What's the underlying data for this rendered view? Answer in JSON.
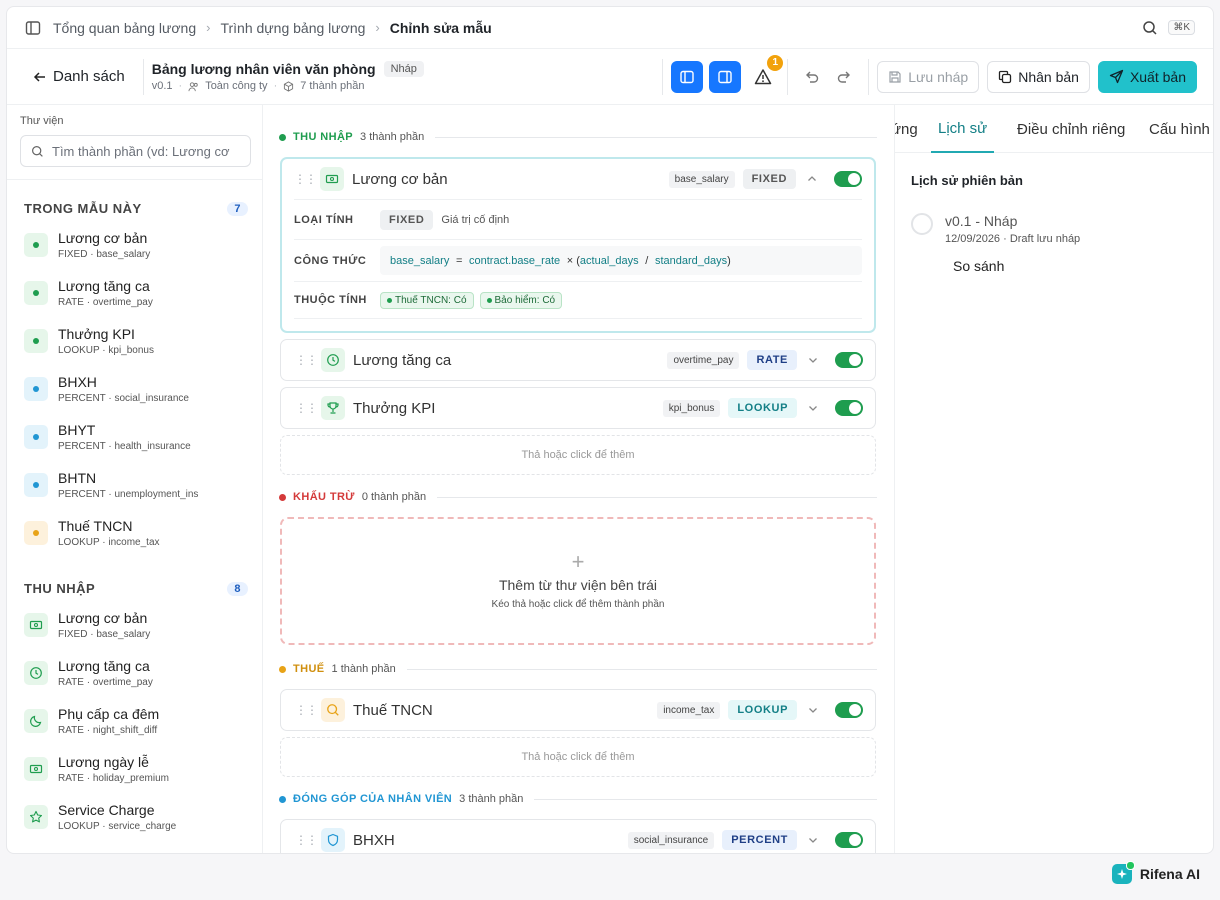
{
  "breadcrumb": [
    "Tổng quan bảng lương",
    "Trình dựng bảng lương",
    "Chỉnh sửa mẫu"
  ],
  "shortcut": "⌘K",
  "toolbar": {
    "back_label": "Danh sách",
    "title": "Bảng lương nhân viên văn phòng",
    "status": "Nháp",
    "version": "v0.1",
    "scope": "Toàn công ty",
    "components": "7 thành phần",
    "warning_count": "1",
    "save_label": "Lưu nháp",
    "duplicate_label": "Nhân bản",
    "publish_label": "Xuất bản"
  },
  "library": {
    "label": "Thư viện",
    "search_placeholder": "Tìm thành phần (vd: Lương cơ",
    "sections": [
      {
        "title": "TRONG MẪU NÀY",
        "count": "7",
        "items": [
          {
            "name": "Lương cơ bản",
            "sub": "FIXED · base_salary",
            "color": "green"
          },
          {
            "name": "Lương tăng ca",
            "sub": "RATE · overtime_pay",
            "color": "green"
          },
          {
            "name": "Thưởng KPI",
            "sub": "LOOKUP · kpi_bonus",
            "color": "green"
          },
          {
            "name": "BHXH",
            "sub": "PERCENT · social_insurance",
            "color": "blue"
          },
          {
            "name": "BHYT",
            "sub": "PERCENT · health_insurance",
            "color": "blue"
          },
          {
            "name": "BHTN",
            "sub": "PERCENT · unemployment_ins",
            "color": "blue"
          },
          {
            "name": "Thuế TNCN",
            "sub": "LOOKUP · income_tax",
            "color": "orange"
          }
        ]
      },
      {
        "title": "THU NHẬP",
        "count": "8",
        "items": [
          {
            "name": "Lương cơ bản",
            "sub": "FIXED · base_salary",
            "icon": "cash-icon"
          },
          {
            "name": "Lương tăng ca",
            "sub": "RATE · overtime_pay",
            "icon": "clock-icon"
          },
          {
            "name": "Phụ cấp ca đêm",
            "sub": "RATE · night_shift_diff",
            "icon": "moon-icon"
          },
          {
            "name": "Lương ngày lễ",
            "sub": "RATE · holiday_premium",
            "icon": "cash-icon"
          },
          {
            "name": "Service Charge",
            "sub": "LOOKUP · service_charge",
            "icon": "star-icon"
          }
        ]
      }
    ]
  },
  "groups": {
    "income": {
      "name": "THU NHẬP",
      "count": "3 thành phần"
    },
    "deduct": {
      "name": "KHẤU TRỪ",
      "count": "0 thành phần"
    },
    "tax": {
      "name": "THUẾ",
      "count": "1 thành phần"
    },
    "contrib": {
      "name": "ĐÓNG GÓP CỦA NHÂN VIÊN",
      "count": "3 thành phần"
    }
  },
  "components": {
    "base": {
      "name": "Lương cơ bản",
      "key": "base_salary",
      "type": "FIXED"
    },
    "ot": {
      "name": "Lương tăng ca",
      "key": "overtime_pay",
      "type": "RATE"
    },
    "kpi": {
      "name": "Thưởng KPI",
      "key": "kpi_bonus",
      "type": "LOOKUP"
    },
    "tax": {
      "name": "Thuế TNCN",
      "key": "income_tax",
      "type": "LOOKUP"
    },
    "bhxh": {
      "name": "BHXH",
      "key": "social_insurance",
      "type": "PERCENT"
    }
  },
  "detail": {
    "calc_label": "LOẠI TÍNH",
    "calc_type": "FIXED",
    "calc_desc": "Giá trị cố định",
    "formula_label": "CÔNG THỨC",
    "f_lhs": "base_salary",
    "f_eq": "=",
    "f_a": "contract.base_rate",
    "f_mul": "× (",
    "f_b": "actual_days",
    "f_div": "/",
    "f_c": "standard_days",
    "f_close": ")",
    "attr_label": "THUỘC TÍNH",
    "attr1": "Thuế TNCN: Có",
    "attr2": "Bảo hiểm: Có"
  },
  "drop_hint": "Thả hoặc click để thêm",
  "empty": {
    "title": "Thêm từ thư viện bên trái",
    "sub": "Kéo thả hoặc click để thêm thành phần"
  },
  "tabs": [
    "ứng",
    "Lịch sử",
    "Điều chỉnh riêng",
    "Cấu hình"
  ],
  "history": {
    "title": "Lịch sử phiên bản",
    "version": "v0.1 - Nháp",
    "date": "12/09/2026 · Draft lưu nháp",
    "compare": "So sánh"
  },
  "brand": "Rifena AI",
  "colors": {
    "accent": "#21c1cb",
    "blue": "#1677ff",
    "green": "#1f9d4f",
    "income": "#1f9d4f",
    "deduct": "#d43a3a",
    "tax": "#e8a317",
    "contrib": "#2196d3"
  }
}
